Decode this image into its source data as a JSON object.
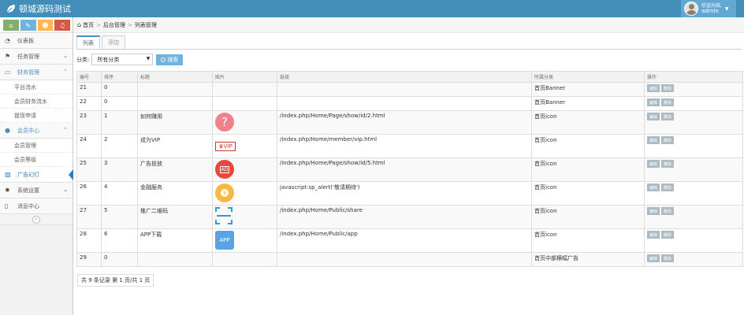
{
  "brand": {
    "title": "顿城源码测试"
  },
  "user": {
    "greeting": "欢迎光临,",
    "name": "admin"
  },
  "sidebar": {
    "items": [
      {
        "label": "仪表板"
      },
      {
        "label": "任务管理"
      },
      {
        "label": "财务管理"
      },
      {
        "label": "平台流水"
      },
      {
        "label": "会员财务流水"
      },
      {
        "label": "提现申请"
      },
      {
        "label": "会员中心"
      },
      {
        "label": "会员管理"
      },
      {
        "label": "会员等级"
      },
      {
        "label": "广告幻灯"
      },
      {
        "label": "系统设置"
      },
      {
        "label": "消息中心"
      }
    ]
  },
  "breadcrumb": {
    "home": "首页",
    "parent": "后台管理",
    "current": "列表管理"
  },
  "tabs": {
    "list": "列表",
    "add": "添加"
  },
  "filter": {
    "label": "分类:",
    "selected": "所有分类",
    "search": "搜索"
  },
  "table": {
    "headers": {
      "id": "编号",
      "order": "排序",
      "title": "标题",
      "image": "图片",
      "link": "链接",
      "category": "所属分类",
      "ops": "操作"
    },
    "edit_label": "编辑",
    "delete_label": "删除",
    "rows": [
      {
        "id": "21",
        "order": "0",
        "title": "",
        "link": "",
        "category": "首页Banner"
      },
      {
        "id": "22",
        "order": "0",
        "title": "",
        "link": "",
        "category": "首页Banner"
      },
      {
        "id": "23",
        "order": "1",
        "title": "如何赚用",
        "image": "question-icon",
        "link": "/index.php/Home/Page/show/id/2.html",
        "category": "首页icon"
      },
      {
        "id": "24",
        "order": "2",
        "title": "成为VIP",
        "image": "vip-icon",
        "image_text": "VIP",
        "link": "/index.php/Home/member/vip.html",
        "category": "首页icon"
      },
      {
        "id": "25",
        "order": "3",
        "title": "广告投放",
        "image": "ad-icon",
        "image_text": "AD",
        "link": "/index.php/Home/Page/show/id/5.html",
        "category": "首页icon"
      },
      {
        "id": "26",
        "order": "4",
        "title": "金融服务",
        "image": "coin-icon",
        "link": "javascript:sp_alert('敬请期待')",
        "category": "首页icon"
      },
      {
        "id": "27",
        "order": "5",
        "title": "推广二维码",
        "image": "qr-scan-icon",
        "link": "/index.php/Home/Public/share",
        "category": "首页icon"
      },
      {
        "id": "28",
        "order": "6",
        "title": "APP下载",
        "image": "app-icon",
        "image_text": "APP",
        "link": "/index.php/Home/Public/app",
        "category": "首页icon"
      },
      {
        "id": "29",
        "order": "0",
        "title": "",
        "link": "",
        "category": "首页中部横幅广告"
      }
    ]
  },
  "pager": {
    "text": "共 9 条记录 第 1 页/共 1 页"
  },
  "colors": {
    "navbar": "#438eb9",
    "accent": "#4c8fbd",
    "op_button": "#abbac3"
  }
}
